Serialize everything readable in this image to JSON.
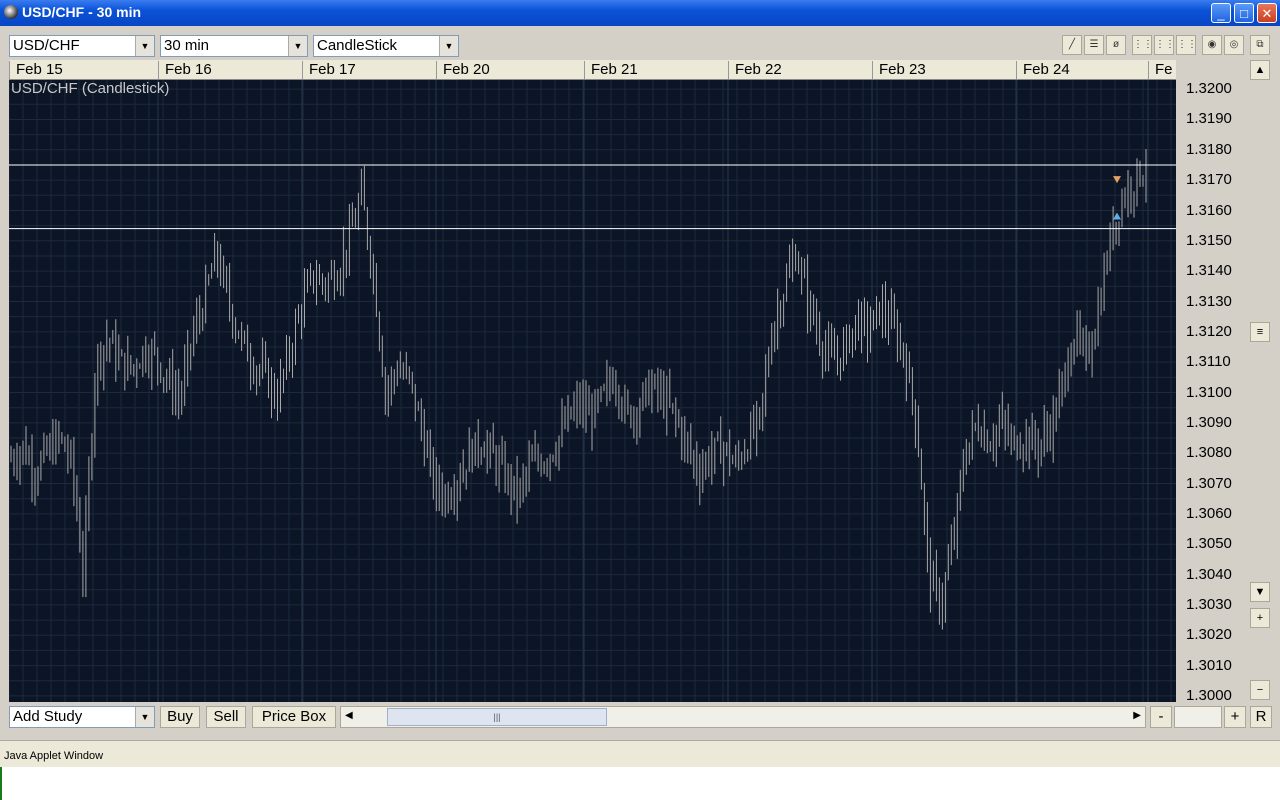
{
  "window": {
    "title": "USD/CHF  - 30 min",
    "minimize": "_",
    "maximize": "□",
    "close": "✕"
  },
  "toolbar": {
    "symbol": "USD/CHF",
    "interval": "30 min",
    "chart_type": "CandleStick",
    "tools": [
      "draw-line-icon",
      "horizontal-lines-icon",
      "fibonacci-icon",
      "grid-icon-1",
      "grid-icon-2",
      "grid-icon-3",
      "zoom-in-icon",
      "zoom-out-icon",
      "detach-icon"
    ]
  },
  "date_axis": [
    "Feb 15",
    "Feb 16",
    "Feb 17",
    "Feb 20",
    "Feb 21",
    "Feb 22",
    "Feb 23",
    "Feb 24",
    "Fe"
  ],
  "chart": {
    "title": "USD/CHF (Candlestick)",
    "background": "#0c1525",
    "candle_color": "#a8a8a8",
    "line_color": "#ffffff",
    "markers": {
      "sell": "#e8a060",
      "buy": "#60b0e8"
    }
  },
  "chart_data": {
    "type": "candlestick",
    "title": "USD/CHF (Candlestick)",
    "x_ticks": [
      "Feb 15",
      "Feb 16",
      "Feb 17",
      "Feb 20",
      "Feb 21",
      "Feb 22",
      "Feb 23",
      "Feb 24"
    ],
    "y_ticks": [
      1.32,
      1.319,
      1.318,
      1.317,
      1.316,
      1.315,
      1.314,
      1.313,
      1.312,
      1.311,
      1.31,
      1.309,
      1.308,
      1.307,
      1.306,
      1.305,
      1.304,
      1.303,
      1.302,
      1.301,
      1.3
    ],
    "ylim": [
      1.2998,
      1.3203
    ],
    "horizontal_lines": [
      1.3175,
      1.3154
    ],
    "close_path": [
      1.3078,
      1.3082,
      1.3074,
      1.308,
      1.3085,
      1.3077,
      1.304,
      1.311,
      1.3118,
      1.311,
      1.3108,
      1.3114,
      1.3112,
      1.3104,
      1.3098,
      1.3118,
      1.313,
      1.3146,
      1.313,
      1.3118,
      1.311,
      1.3106,
      1.3098,
      1.3112,
      1.3128,
      1.3138,
      1.3136,
      1.314,
      1.315,
      1.3165,
      1.314,
      1.31,
      1.3108,
      1.3104,
      1.3088,
      1.307,
      1.3066,
      1.3072,
      1.308,
      1.3084,
      1.3078,
      1.3072,
      1.3066,
      1.3076,
      1.3078,
      1.3082,
      1.309,
      1.3096,
      1.3092,
      1.3098,
      1.3106,
      1.3092,
      1.3096,
      1.3102,
      1.3098,
      1.3092,
      1.3082,
      1.3074,
      1.308,
      1.3082,
      1.3076,
      1.3084,
      1.309,
      1.312,
      1.3134,
      1.3146,
      1.313,
      1.3118,
      1.311,
      1.3114,
      1.3124,
      1.312,
      1.3128,
      1.3122,
      1.3112,
      1.309,
      1.304,
      1.303,
      1.305,
      1.308,
      1.309,
      1.3084,
      1.309,
      1.3082,
      1.3086,
      1.3082,
      1.3088,
      1.31,
      1.312,
      1.311,
      1.3126,
      1.315,
      1.3164,
      1.317,
      1.3175
    ],
    "markers": [
      {
        "type": "sell",
        "price": 1.317,
        "date": "Feb 24"
      },
      {
        "type": "buy",
        "price": 1.3158,
        "date": "Feb 24"
      }
    ]
  },
  "price_axis": [
    "1.3200",
    "1.3190",
    "1.3180",
    "1.3170",
    "1.3160",
    "1.3150",
    "1.3140",
    "1.3130",
    "1.3120",
    "1.3110",
    "1.3100",
    "1.3090",
    "1.3080",
    "1.3070",
    "1.3060",
    "1.3050",
    "1.3040",
    "1.3030",
    "1.3020",
    "1.3010",
    "1.3000"
  ],
  "bottom": {
    "add_study": "Add Study",
    "buy": "Buy",
    "sell": "Sell",
    "price_box": "Price Box",
    "minus": "-",
    "plus": "+",
    "reset": "R"
  },
  "status": {
    "text": "Java Applet Window"
  }
}
